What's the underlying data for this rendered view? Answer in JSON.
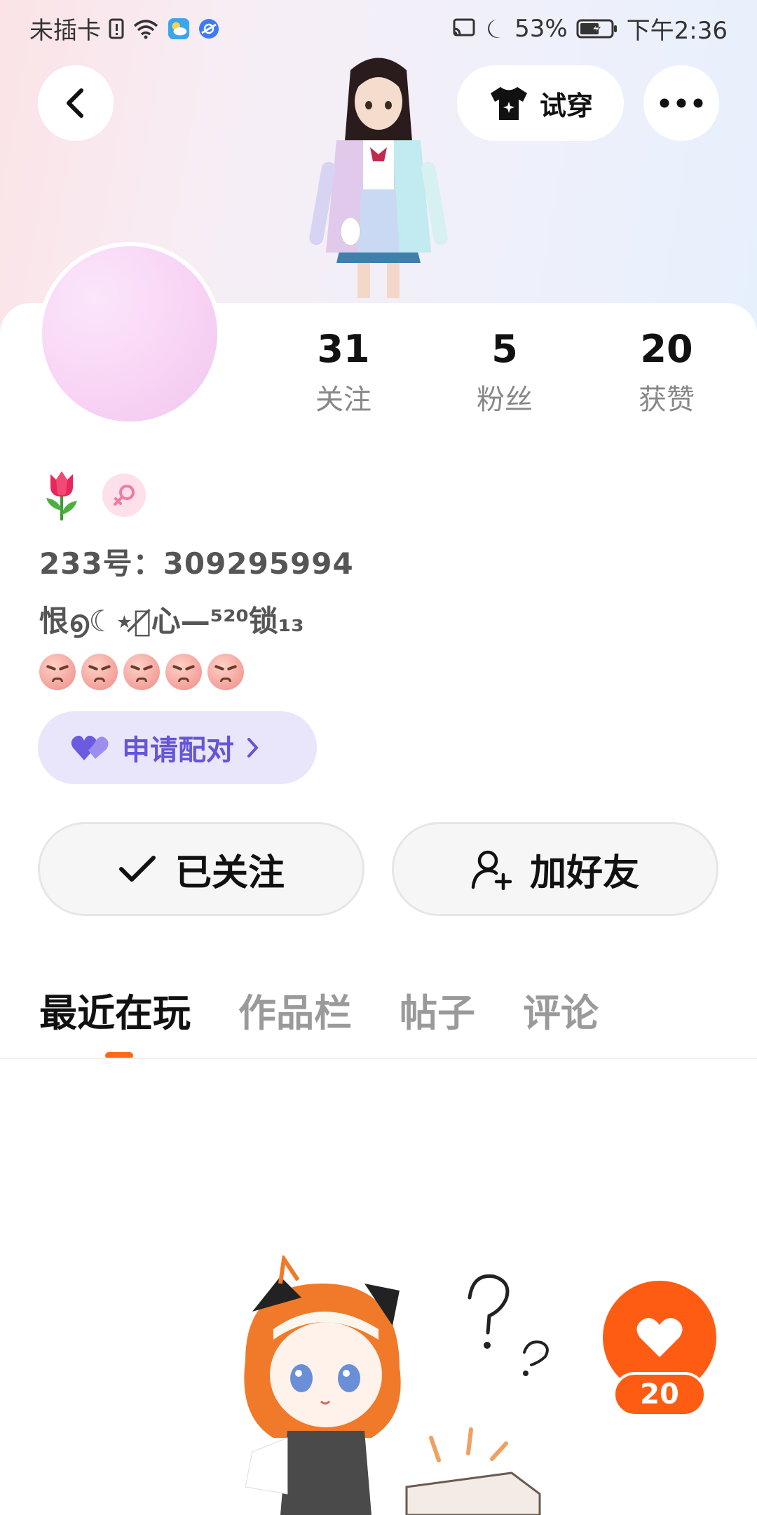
{
  "status_bar": {
    "carrier": "未插卡",
    "battery": "53%",
    "time": "下午2:36"
  },
  "header": {
    "try_on_label": "试穿",
    "icons": [
      "back-arrow-icon",
      "tshirt-icon",
      "more-icon"
    ]
  },
  "stats": [
    {
      "value": "31",
      "label": "关注"
    },
    {
      "value": "5",
      "label": "粉丝"
    },
    {
      "value": "20",
      "label": "获赞"
    }
  ],
  "profile": {
    "uid_text": "233号：309295994",
    "signature": "恨൭☾⋆封̸心—⁵²⁰锁₁₃",
    "pair_label": "申请配对"
  },
  "actions": {
    "followed_label": "已关注",
    "add_friend_label": "加好友"
  },
  "tabs": [
    {
      "label": "最近在玩",
      "active": true
    },
    {
      "label": "作品栏",
      "active": false
    },
    {
      "label": "帖子",
      "active": false
    },
    {
      "label": "评论",
      "active": false
    }
  ],
  "like_fab": {
    "count": "20"
  },
  "colors": {
    "accent_orange": "#fe5c12",
    "pair_purple": "#6556d6",
    "pair_bg": "#e9e6fb"
  }
}
